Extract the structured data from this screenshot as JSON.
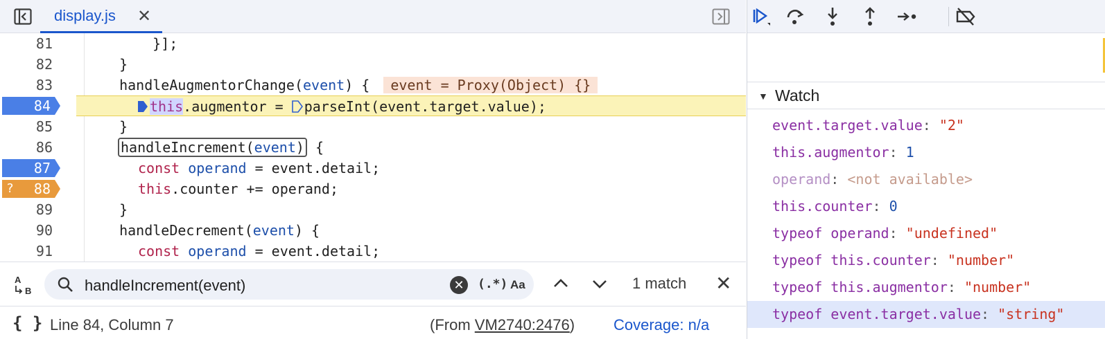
{
  "editor": {
    "tab": {
      "filename": "display.js"
    },
    "lines": [
      {
        "num": "81",
        "text": "    }];"
      },
      {
        "num": "82",
        "text": "  }"
      },
      {
        "num": "83",
        "pre": "  handleAugmentorChange(",
        "param": "event",
        "post": ") {",
        "inline": "event = Proxy(Object) {}"
      },
      {
        "num": "84",
        "kw": "this",
        "mid": ".augmentor = ",
        "post": "parseInt(event.target.value);"
      },
      {
        "num": "85",
        "text": "  }"
      },
      {
        "num": "86",
        "boxed": "handleIncrement(",
        "param": "event",
        "boxed_close": ")",
        "post": " {"
      },
      {
        "num": "87",
        "kw": "const",
        "sp": " ",
        "var": "operand",
        "post": " = event.detail;"
      },
      {
        "num": "88",
        "kw": "this",
        "post": ".counter += operand;"
      },
      {
        "num": "89",
        "text": "  }"
      },
      {
        "num": "90",
        "pre": "  handleDecrement(",
        "param": "event",
        "post": ") {"
      },
      {
        "num": "91",
        "kw": "const",
        "sp": " ",
        "var": "operand",
        "post": " = event.detail;"
      }
    ],
    "breakpoints": {
      "active_line": "84",
      "blue": [
        "84",
        "87"
      ],
      "conditional": {
        "line": "88",
        "mark": "?"
      }
    }
  },
  "search": {
    "value": "handleIncrement(event)",
    "regex_label": "(.*)",
    "case_label": "Aa",
    "match_count": "1 match"
  },
  "status": {
    "braces": "{ }",
    "position": "Line 84, Column 7",
    "from_prefix": "(From ",
    "from_link": "VM2740:2476",
    "from_suffix": ")",
    "coverage": "Coverage: n/a"
  },
  "watch": {
    "title": "Watch",
    "items": [
      {
        "expr": "event.target.value",
        "value": "\"2\"",
        "type": "str"
      },
      {
        "expr": "this.augmentor",
        "value": "1",
        "type": "num"
      },
      {
        "expr": "operand",
        "value": "<not available>",
        "type": "na"
      },
      {
        "expr": "this.counter",
        "value": "0",
        "type": "num"
      },
      {
        "expr": "typeof operand",
        "value": "\"undefined\"",
        "type": "str"
      },
      {
        "expr": "typeof this.counter",
        "value": "\"number\"",
        "type": "str"
      },
      {
        "expr": "typeof this.augmentor",
        "value": "\"number\"",
        "type": "str"
      },
      {
        "expr": "typeof event.target.value",
        "value": "\"string\"",
        "type": "str",
        "selected": true
      }
    ]
  },
  "colors": {
    "accent": "#1a56cc",
    "breakpoint_blue": "#4a7fe6",
    "breakpoint_conditional": "#e89a3c",
    "exec_line_bg": "#fbf3b8"
  },
  "icons": {
    "nav_toggle": "sidebar-toggle-icon",
    "debug_toggle": "debugger-sidebar-toggle-icon",
    "resume": "resume-icon",
    "step_over": "step-over-icon",
    "step_into": "step-into-icon",
    "step_out": "step-out-icon",
    "step": "step-icon",
    "deactivate_breakpoints": "deactivate-breakpoints-icon"
  }
}
